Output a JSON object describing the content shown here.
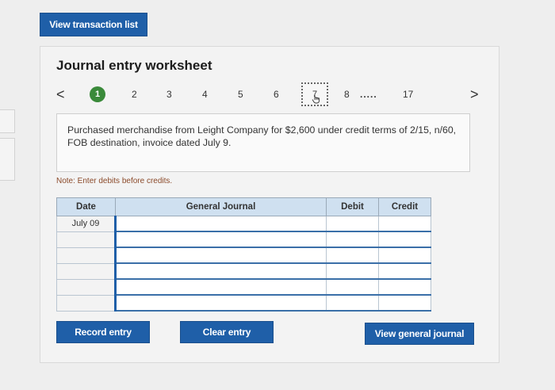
{
  "top_button": {
    "label": "View transaction list"
  },
  "worksheet": {
    "title": "Journal entry worksheet",
    "steps": [
      "1",
      "2",
      "3",
      "4",
      "5",
      "6",
      "7",
      "8",
      ".....",
      "17"
    ],
    "active_step": "1",
    "selected_step": "7",
    "prev_arrow": "<",
    "next_arrow": ">",
    "description": "Purchased merchandise from Leight Company for $2,600 under credit terms of 2/15, n/60, FOB destination, invoice dated July 9.",
    "note": "Note: Enter debits before credits."
  },
  "table": {
    "headers": {
      "date": "Date",
      "general_journal": "General Journal",
      "debit": "Debit",
      "credit": "Credit"
    },
    "first_date": "July 09",
    "row_count": 6
  },
  "buttons": {
    "record": "Record entry",
    "clear": "Clear entry",
    "view_journal": "View general journal"
  },
  "colors": {
    "accent": "#1f5fa8",
    "active_step": "#3a8a3a",
    "header_bg": "#cfe0f0"
  }
}
